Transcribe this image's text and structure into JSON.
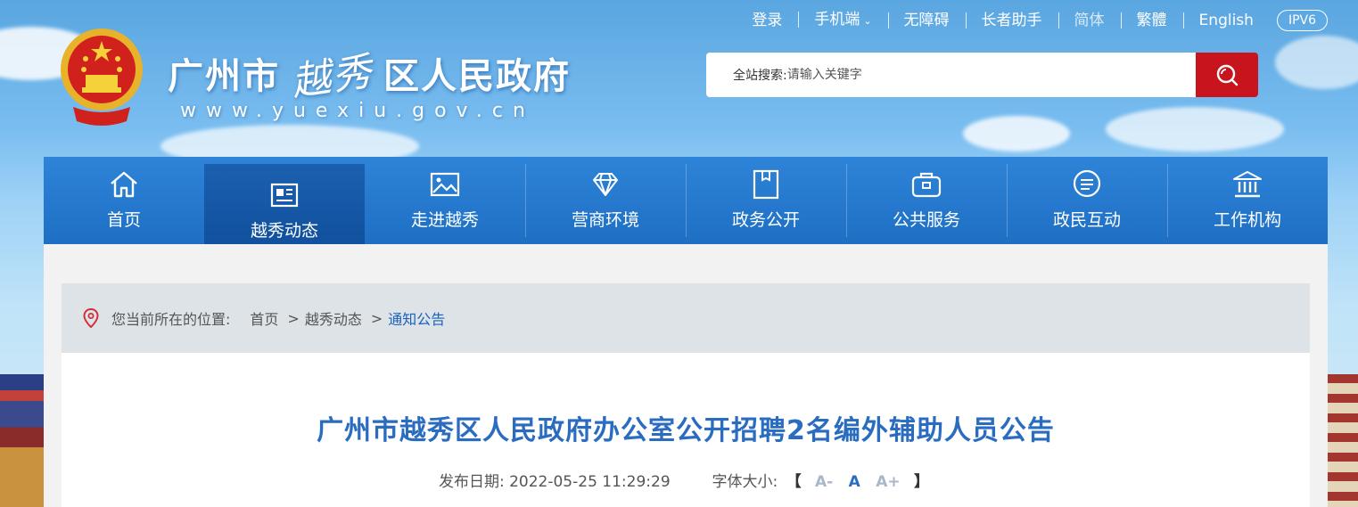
{
  "colors": {
    "accent": "#1e6fc4",
    "search_button": "#c8141c",
    "title": "#2a6cc0"
  },
  "topbar": {
    "login": "登录",
    "mobile": "手机端",
    "accessible": "无障碍",
    "elderly": "长者助手",
    "simplified": "简体",
    "traditional": "繁體",
    "english": "English",
    "ipv6": "IPV6"
  },
  "site": {
    "name_prefix": "广州市",
    "name_script": "越秀",
    "name_suffix": "区人民政府",
    "url": "www.yuexiu.gov.cn"
  },
  "search": {
    "label": "全站搜索:",
    "placeholder": "请输入关键字",
    "icon": "search-icon"
  },
  "nav": [
    {
      "label": "首页",
      "icon": "home-icon"
    },
    {
      "label": "越秀动态",
      "icon": "newspaper-icon",
      "active": true
    },
    {
      "label": "走进越秀",
      "icon": "picture-icon"
    },
    {
      "label": "营商环境",
      "icon": "diamond-icon"
    },
    {
      "label": "政务公开",
      "icon": "folder-icon"
    },
    {
      "label": "公共服务",
      "icon": "briefcase-icon"
    },
    {
      "label": "政民互动",
      "icon": "chat-icon"
    },
    {
      "label": "工作机构",
      "icon": "institution-icon"
    }
  ],
  "breadcrumb": {
    "prefix": "您当前所在的位置:",
    "home": "首页",
    "sep": ">",
    "section": "越秀动态",
    "current": "通知公告"
  },
  "article": {
    "title": "广州市越秀区人民政府办公室公开招聘2名编外辅助人员公告",
    "date_label": "发布日期:",
    "date": "2022-05-25 11:29:29",
    "font_label": "字体大小:",
    "bracket_open": "【",
    "bracket_close": "】",
    "font_small": "A-",
    "font_medium": "A",
    "font_large": "A+"
  }
}
